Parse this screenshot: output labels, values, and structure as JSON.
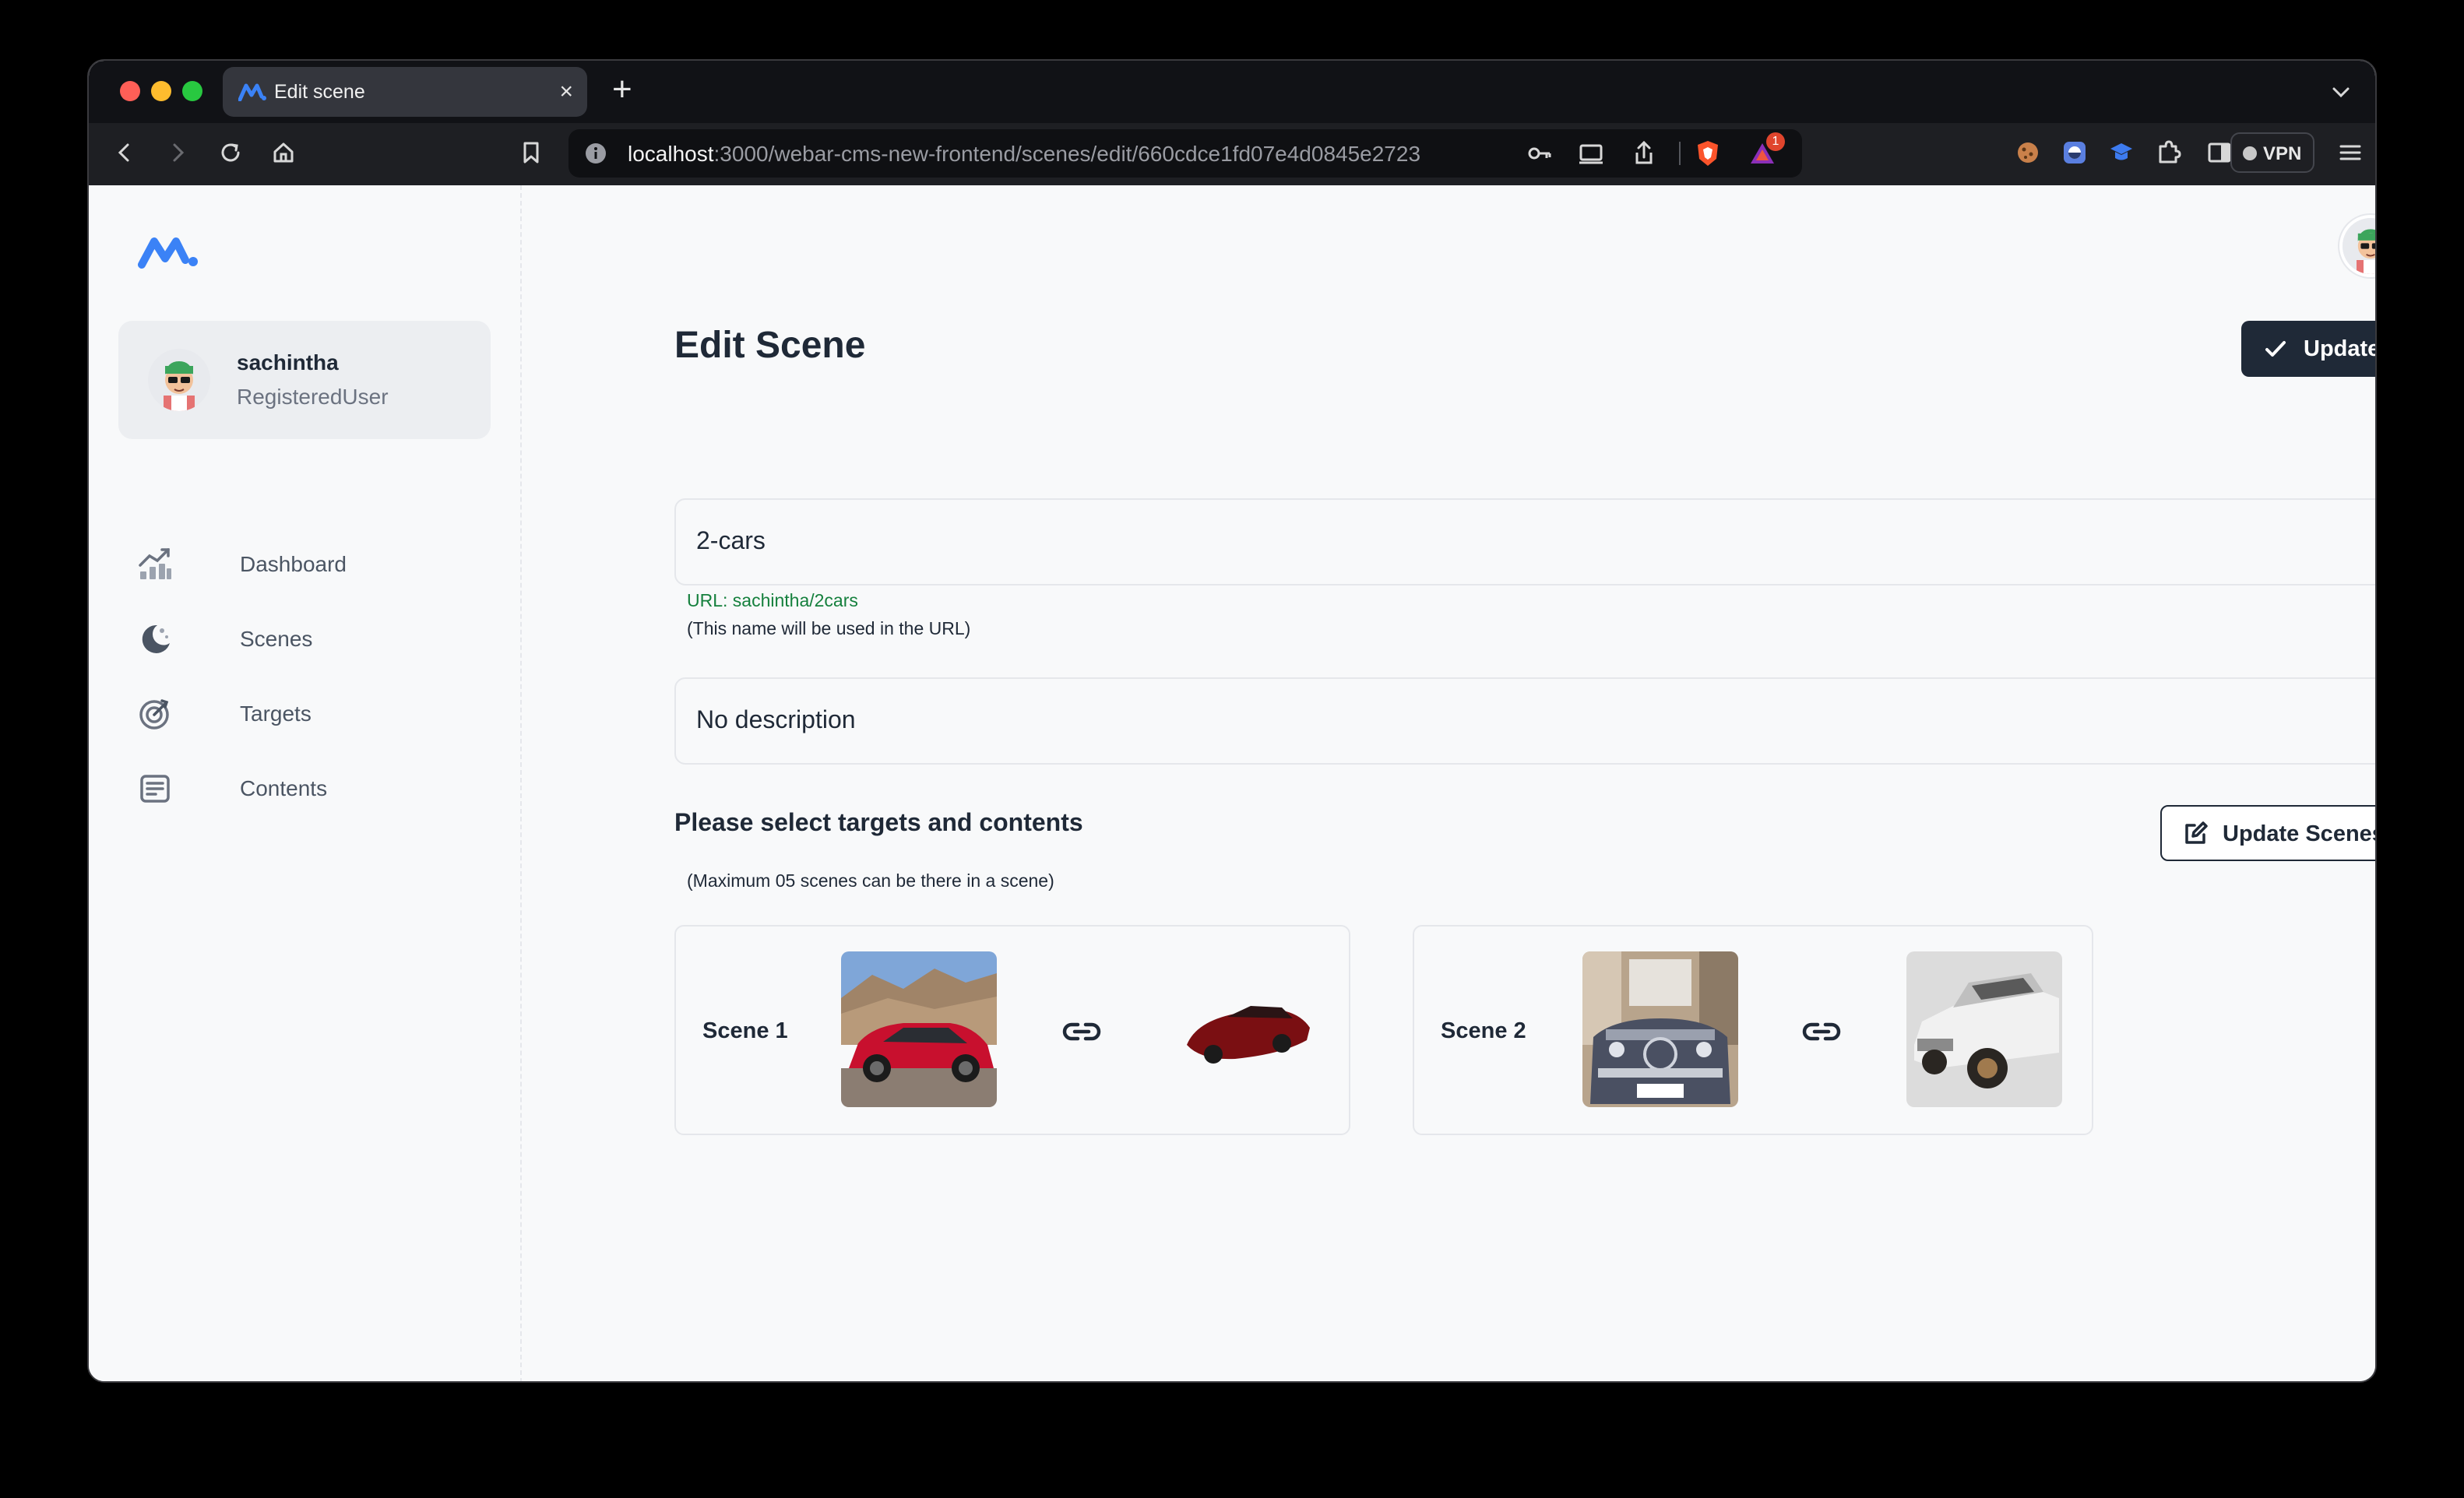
{
  "browser": {
    "tab_title": "Edit scene",
    "tab_close": "×",
    "new_tab": "+",
    "url_host": "localhost",
    "url_path": ":3000/webar-cms-new-frontend/scenes/edit/660cdce1fd07e4d0845e2723",
    "vpn_label": "VPN",
    "notification_count": "1"
  },
  "user": {
    "name": "sachintha",
    "role": "RegisteredUser"
  },
  "nav": {
    "items": [
      {
        "label": "Dashboard",
        "icon": "chart-icon"
      },
      {
        "label": "Scenes",
        "icon": "moon-icon"
      },
      {
        "label": "Targets",
        "icon": "target-icon"
      },
      {
        "label": "Contents",
        "icon": "contents-icon"
      }
    ]
  },
  "page": {
    "title": "Edit Scene",
    "update_label": "Update",
    "name_value": "2-cars",
    "url_hint": "URL: sachintha/2cars",
    "name_hint": "(This name will be used in the URL)",
    "description_value": "No description",
    "section_title": "Please select targets and contents",
    "section_subtitle": "(Maximum 05 scenes can be there in a scene)",
    "update_scenes_label": "Update Scenes"
  },
  "scenes": [
    {
      "label": "Scene 1",
      "target": "red-coupe-photo",
      "content": "red-car-3d-model"
    },
    {
      "label": "Scene 2",
      "target": "vintage-convertible-photo",
      "content": "vintage-sedan-3d-model"
    }
  ],
  "colors": {
    "accent_dark": "#1f2937",
    "brand_blue": "#3b82f6",
    "success_green": "#15803d",
    "page_bg": "#f8f9fa"
  }
}
